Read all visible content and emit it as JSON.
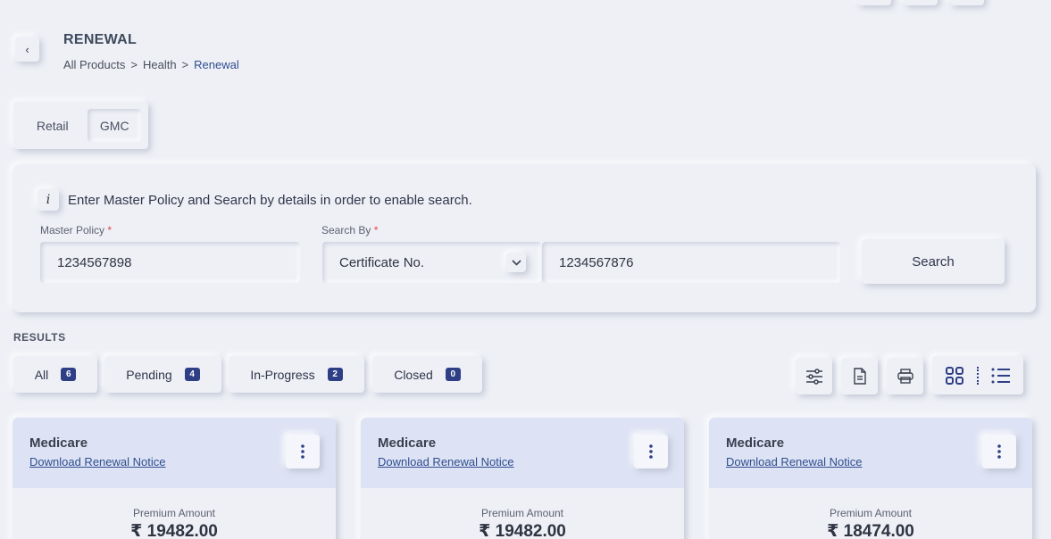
{
  "header": {
    "back_icon": "chevron-left-icon",
    "title": "RENEWAL",
    "breadcrumb": [
      "All Products",
      "Health",
      "Renewal"
    ],
    "breadcrumb_separator": ">"
  },
  "segment": {
    "options": [
      "Retail",
      "GMC"
    ],
    "selected": "GMC"
  },
  "search": {
    "info_icon": "info-icon",
    "info_text": "Enter Master Policy and Search by details in order to enable search.",
    "master_policy_label": "Master Policy",
    "master_policy_value": "1234567898",
    "search_by_label": "Search By",
    "search_by_value": "Certificate No.",
    "search_value": "1234567876",
    "required_mark": "*",
    "button_label": "Search"
  },
  "results": {
    "label": "RESULTS",
    "filters": [
      {
        "label": "All",
        "count": "6"
      },
      {
        "label": "Pending",
        "count": "4"
      },
      {
        "label": "In-Progress",
        "count": "2"
      },
      {
        "label": "Closed",
        "count": "0"
      }
    ],
    "tools": [
      "sliders-icon",
      "export-document-icon",
      "printer-icon",
      "grid-view-icon",
      "list-view-icon"
    ],
    "active_view": "grid"
  },
  "cards": [
    {
      "title": "Medicare",
      "link": "Download Renewal Notice",
      "premium_label": "Premium Amount",
      "premium_amount": "₹ 19482.00"
    },
    {
      "title": "Medicare",
      "link": "Download Renewal Notice",
      "premium_label": "Premium Amount",
      "premium_amount": "₹ 19482.00"
    },
    {
      "title": "Medicare",
      "link": "Download Renewal Notice",
      "premium_label": "Premium Amount",
      "premium_amount": "₹ 18474.00"
    }
  ],
  "colors": {
    "background": "#eef0f6",
    "accent": "#2f3f86",
    "link": "#2f4d8f",
    "required": "#e0444c",
    "card_header": "#dde3f4"
  }
}
